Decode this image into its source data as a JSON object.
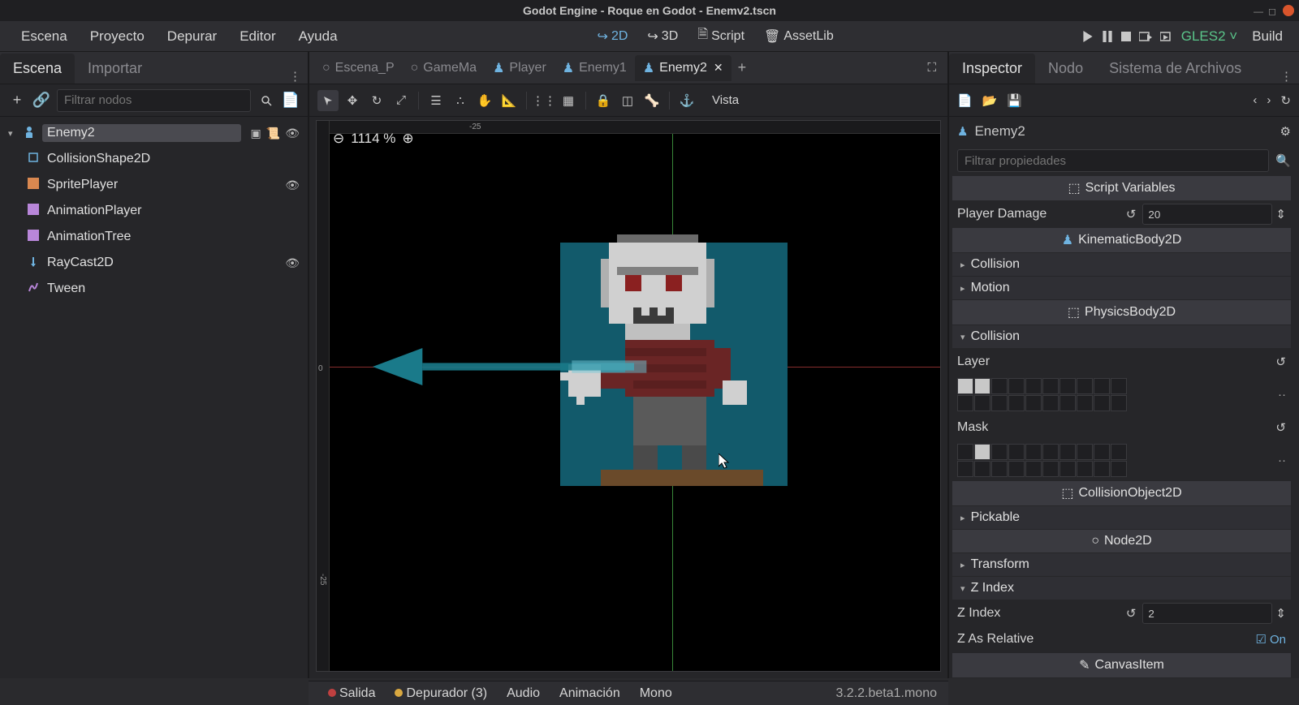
{
  "window": {
    "title": "Godot Engine - Roque en Godot - Enemv2.tscn"
  },
  "menu": {
    "escena": "Escena",
    "proyecto": "Proyecto",
    "depurar": "Depurar",
    "editor": "Editor",
    "ayuda": "Ayuda"
  },
  "mode": {
    "d2": "2D",
    "d3": "3D",
    "script": "Script",
    "assetlib": "AssetLib"
  },
  "renderer": "GLES2",
  "build": "Build",
  "left_tabs": {
    "escena": "Escena",
    "importar": "Importar"
  },
  "scene_filter_placeholder": "Filtrar nodos",
  "tree": {
    "root": "Enemy2",
    "children": [
      {
        "name": "CollisionShape2D",
        "icon": "square-blue"
      },
      {
        "name": "SpritePlayer",
        "icon": "sprite"
      },
      {
        "name": "AnimationPlayer",
        "icon": "anim"
      },
      {
        "name": "AnimationTree",
        "icon": "anim"
      },
      {
        "name": "RayCast2D",
        "icon": "ray"
      },
      {
        "name": "Tween",
        "icon": "tween"
      }
    ]
  },
  "scene_tabs": [
    {
      "label": "Escena_P",
      "icon": "circle"
    },
    {
      "label": "GameMa",
      "icon": "circle"
    },
    {
      "label": "Player",
      "icon": "body-blue"
    },
    {
      "label": "Enemy1",
      "icon": "body-blue"
    },
    {
      "label": "Enemy2",
      "icon": "body-blue",
      "active": true,
      "closable": true
    }
  ],
  "vista_label": "Vista",
  "zoom": "1114 %",
  "right_tabs": {
    "inspector": "Inspector",
    "nodo": "Nodo",
    "fs": "Sistema de Archivos"
  },
  "inspector": {
    "node": "Enemy2",
    "filter_placeholder": "Filtrar propiedades",
    "script_vars": "Script Variables",
    "player_damage_label": "Player Damage",
    "player_damage_value": "20",
    "kinematic": "KinematicBody2D",
    "collision": "Collision",
    "motion": "Motion",
    "physicsbody": "PhysicsBody2D",
    "layer": "Layer",
    "mask": "Mask",
    "collisionobj": "CollisionObject2D",
    "pickable": "Pickable",
    "node2d": "Node2D",
    "transform": "Transform",
    "zindex": "Z Index",
    "zindex_val": "2",
    "zrel": "Z As Relative",
    "zrel_val": "On",
    "canvasitem": "CanvasItem"
  },
  "bottom": {
    "salida": "Salida",
    "depurador": "Depurador (3)",
    "audio": "Audio",
    "animacion": "Animación",
    "mono": "Mono",
    "version": "3.2.2.beta1.mono"
  },
  "ruler_ticks": {
    "h_neg25": "-25",
    "v_neg25": "-25",
    "v_zero": "0"
  }
}
